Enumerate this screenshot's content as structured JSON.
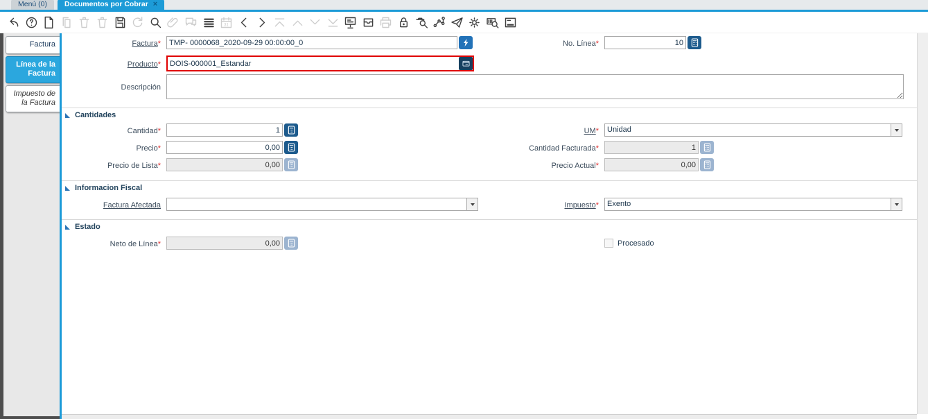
{
  "window_tabs": [
    {
      "label": "Menú (0)",
      "active": false
    },
    {
      "label": "Documentos por Cobrar",
      "active": true,
      "closable": true
    }
  ],
  "ui": {
    "mandatory_mark": "*",
    "close_icon": "×",
    "calendar_label": "31"
  },
  "colors": {
    "accent_blue": "#1d9bd7",
    "sidebar_active_blue": "#2ba7de",
    "highlight_red": "#e00000",
    "calc_button_blue": "#1d5b8d",
    "record_button_blue": "#2272b8",
    "info_button_navy": "#16405f"
  },
  "toolbar": {
    "items": [
      {
        "name": "undo",
        "enabled": true
      },
      {
        "name": "help",
        "enabled": true
      },
      {
        "name": "new-record",
        "enabled": true
      },
      {
        "name": "copy-record",
        "enabled": false
      },
      {
        "name": "delete-record",
        "enabled": false
      },
      {
        "name": "delete-selection",
        "enabled": false
      },
      {
        "name": "save",
        "enabled": true
      },
      {
        "name": "refresh",
        "enabled": false
      },
      {
        "name": "find",
        "enabled": true
      },
      {
        "name": "attachment",
        "enabled": false
      },
      {
        "name": "chat",
        "enabled": false
      },
      {
        "name": "grid-toggle",
        "enabled": true
      },
      {
        "name": "calendar",
        "enabled": false
      },
      {
        "name": "previous-record",
        "enabled": true
      },
      {
        "name": "next-record",
        "enabled": true
      },
      {
        "name": "first-record",
        "enabled": false
      },
      {
        "name": "parent-record",
        "enabled": false
      },
      {
        "name": "detail-record",
        "enabled": false
      },
      {
        "name": "last-record",
        "enabled": false
      },
      {
        "name": "report",
        "enabled": true
      },
      {
        "name": "archive",
        "enabled": true
      },
      {
        "name": "print",
        "enabled": false
      },
      {
        "name": "lock",
        "enabled": true
      },
      {
        "name": "zoom-across",
        "enabled": true
      },
      {
        "name": "workflow",
        "enabled": true
      },
      {
        "name": "requests",
        "enabled": true
      },
      {
        "name": "preferences",
        "enabled": true
      },
      {
        "name": "product-info",
        "enabled": true
      },
      {
        "name": "detail-panel",
        "enabled": true
      }
    ]
  },
  "sidebar": {
    "tabs": [
      {
        "label": "Factura",
        "active": false,
        "italic": false
      },
      {
        "label": "Línea de la Factura",
        "active": true,
        "italic": false
      },
      {
        "label": "Impuesto de la Factura",
        "active": false,
        "italic": true
      }
    ]
  },
  "sections": {
    "cantidades": "Cantidades",
    "informacion_fiscal": "Informacion Fiscal",
    "estado": "Estado"
  },
  "form": {
    "factura": {
      "label": "Factura",
      "value": "TMP- 0000068_2020-09-29 00:00:00_0"
    },
    "no_linea": {
      "label": "No. Línea",
      "value": "10"
    },
    "producto": {
      "label": "Producto",
      "value": "DOIS-000001_Estandar"
    },
    "descripcion": {
      "label": "Descripción",
      "value": ""
    },
    "cantidad": {
      "label": "Cantidad",
      "value": "1"
    },
    "um": {
      "label": "UM",
      "value": "Unidad"
    },
    "precio": {
      "label": "Precio",
      "value": "0,00"
    },
    "cantidad_facturada": {
      "label": "Cantidad Facturada",
      "value": "1"
    },
    "precio_de_lista": {
      "label": "Precio de Lista",
      "value": "0,00"
    },
    "precio_actual": {
      "label": "Precio Actual",
      "value": "0,00"
    },
    "factura_afectada": {
      "label": "Factura Afectada",
      "value": ""
    },
    "impuesto": {
      "label": "Impuesto",
      "value": "Exento"
    },
    "neto_de_linea": {
      "label": "Neto de Línea",
      "value": "0,00"
    },
    "procesado": {
      "label": "Procesado",
      "checked": false
    }
  }
}
